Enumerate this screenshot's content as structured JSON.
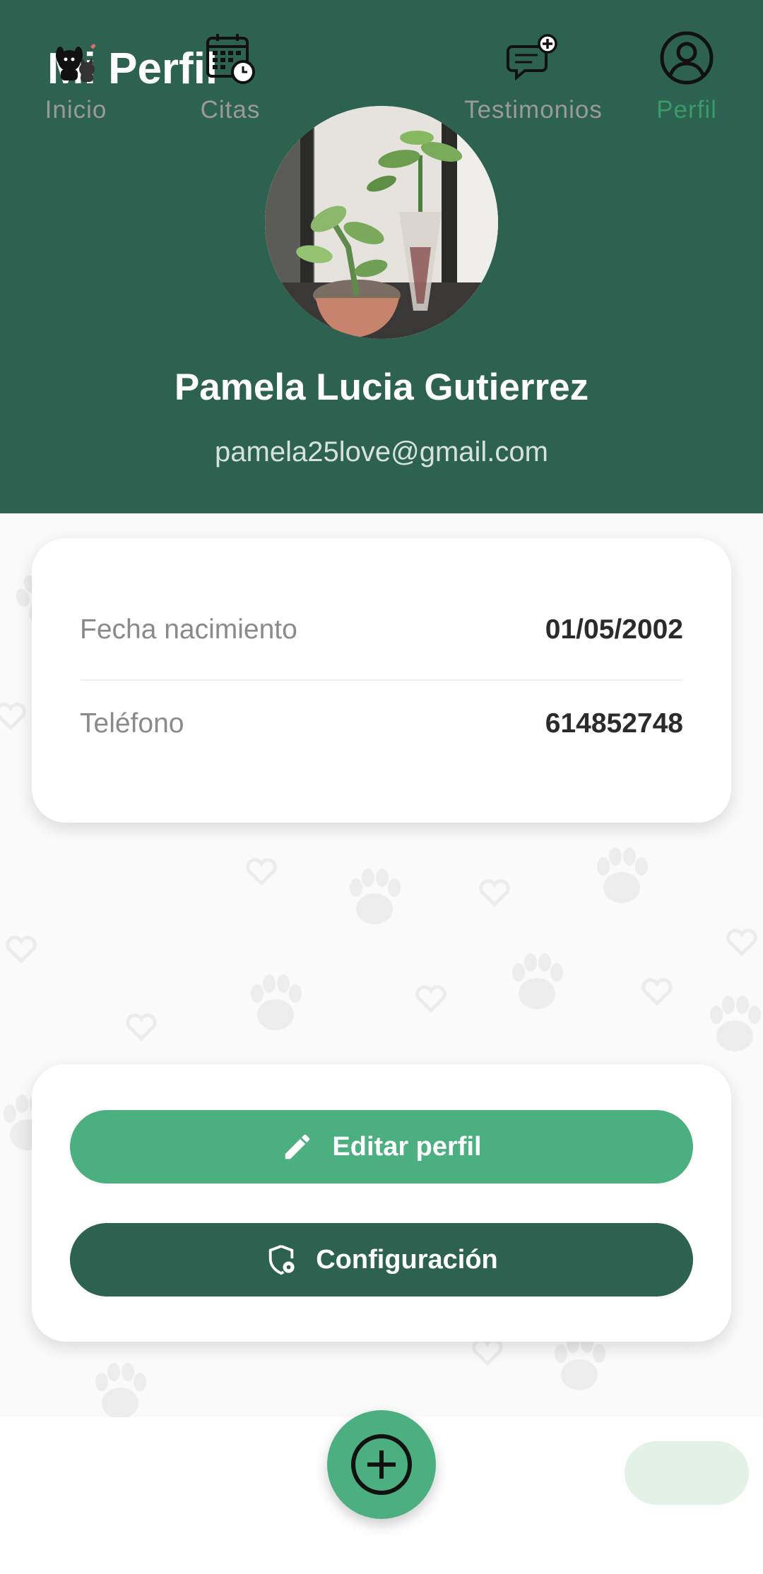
{
  "header": {
    "title": "Mi Perfil",
    "name": "Pamela Lucia Gutierrez",
    "email": "pamela25love@gmail.com"
  },
  "info": {
    "birthdate_label": "Fecha nacimiento",
    "birthdate_value": "01/05/2002",
    "phone_label": "Teléfono",
    "phone_value": "614852748"
  },
  "actions": {
    "edit_label": "Editar perfil",
    "config_label": "Configuración"
  },
  "nav": {
    "items": [
      {
        "label": "Inicio",
        "icon": "pets-icon"
      },
      {
        "label": "Citas",
        "icon": "calendar-clock-icon"
      },
      {
        "label": "Testimonios",
        "icon": "chat-plus-icon"
      },
      {
        "label": "Perfil",
        "icon": "user-circle-icon"
      }
    ],
    "fab_icon": "add-circle-icon"
  },
  "colors": {
    "primary_dark": "#2d6150",
    "primary": "#4caf80",
    "active_bg": "#e2f2e6",
    "active_label": "#3a9a6a"
  }
}
